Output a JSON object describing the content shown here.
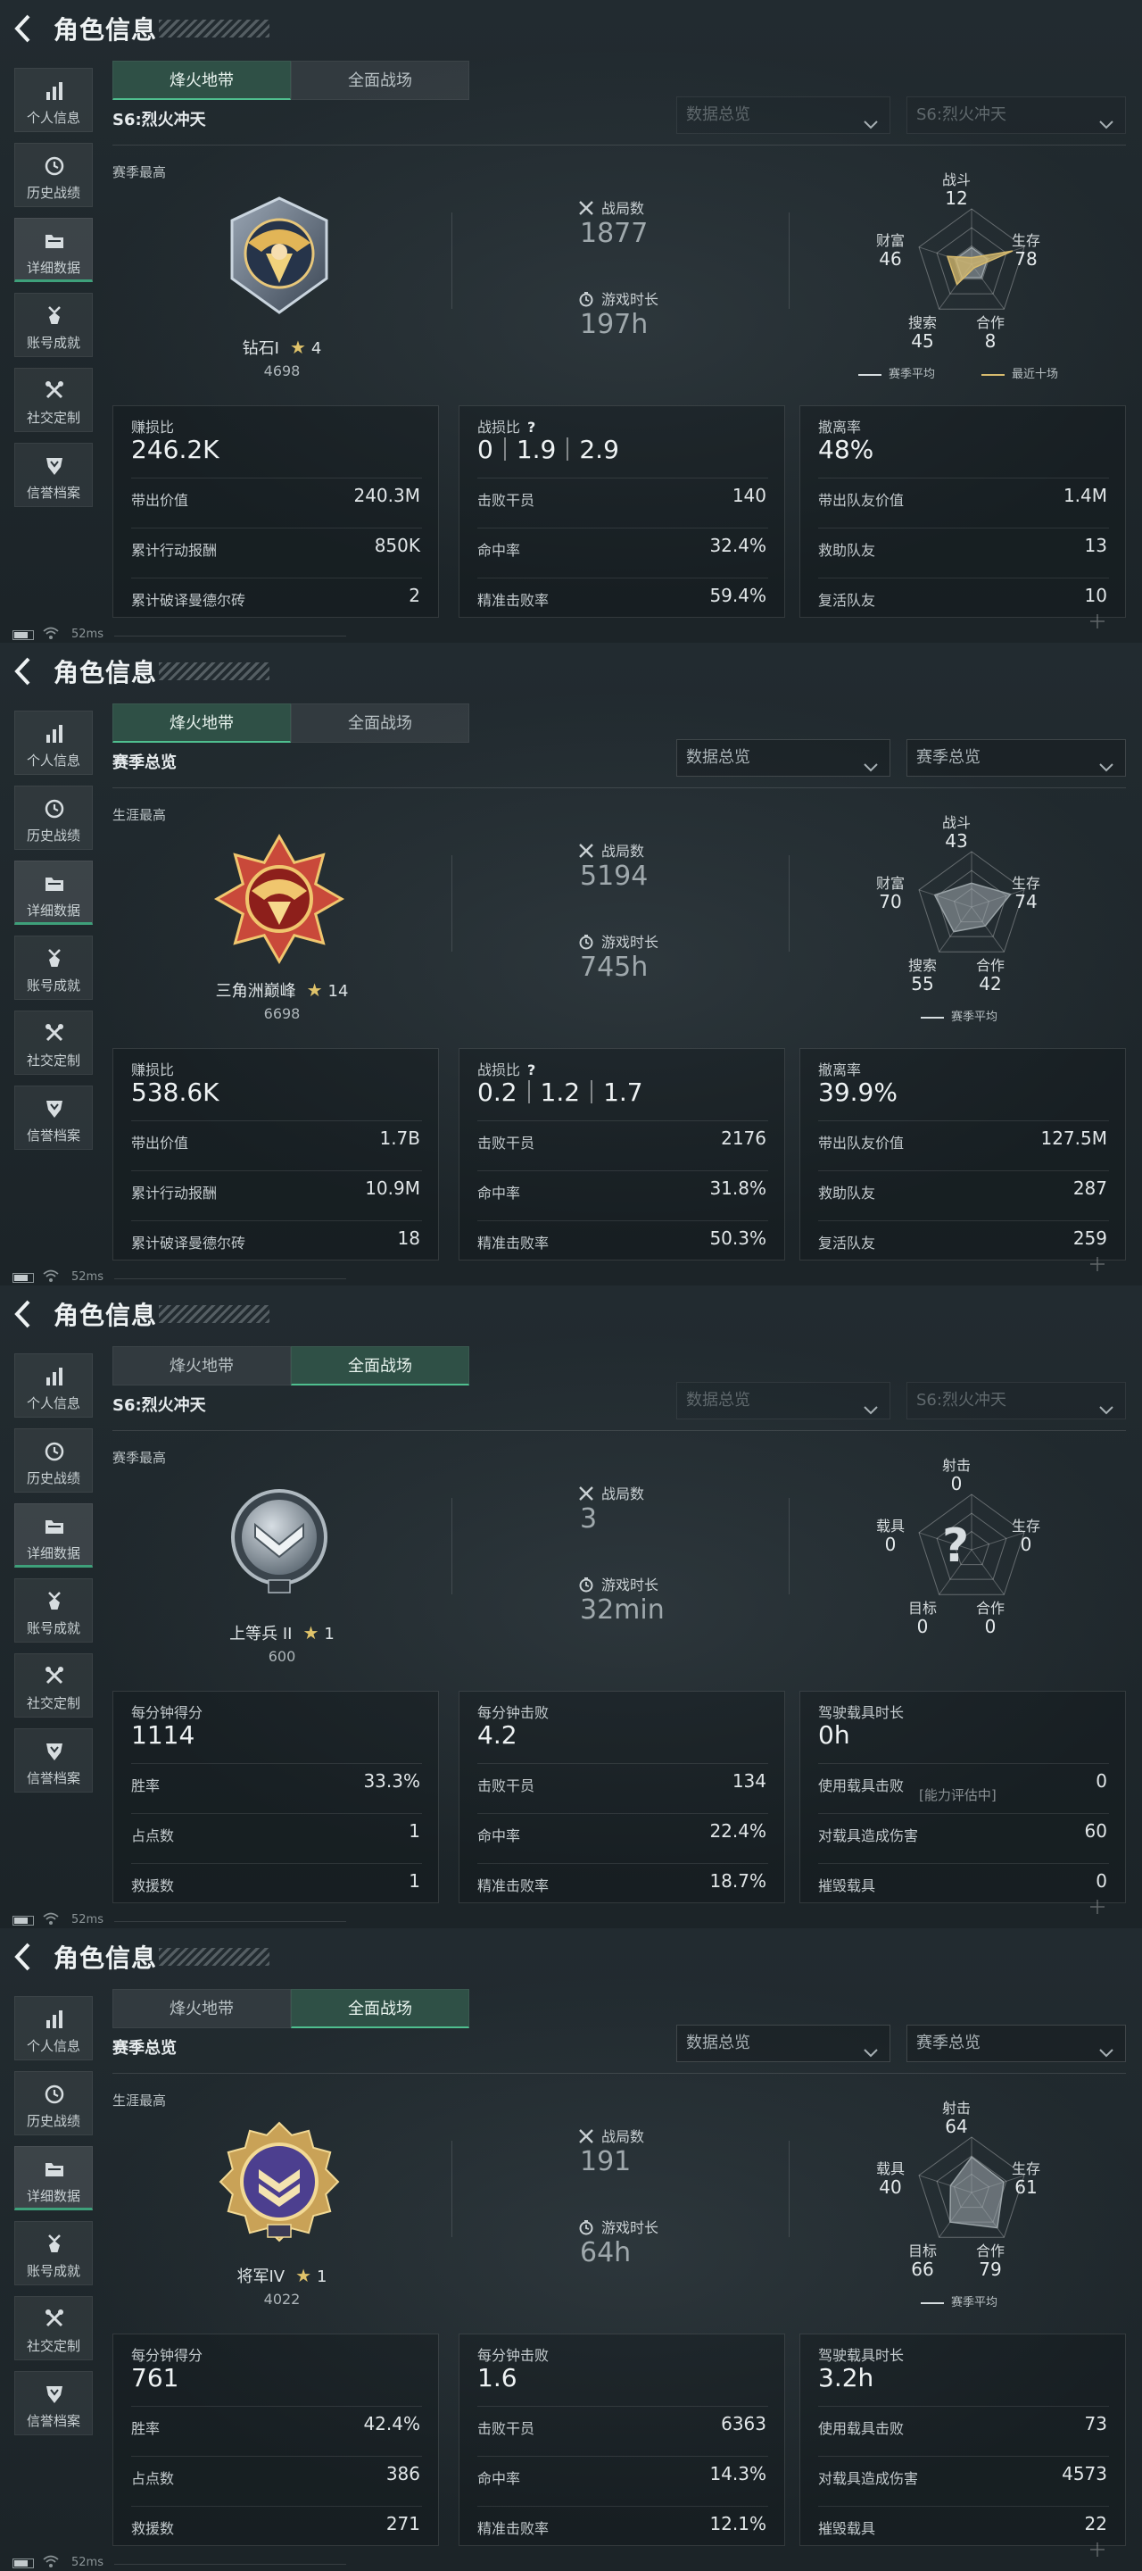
{
  "header": {
    "title": "角色信息"
  },
  "sidebar": {
    "items": [
      {
        "label": "个人信息",
        "icon": "bar-chart-icon"
      },
      {
        "label": "历史战绩",
        "icon": "clock-icon"
      },
      {
        "label": "详细数据",
        "icon": "folder-icon"
      },
      {
        "label": "账号成就",
        "icon": "medal-icon"
      },
      {
        "label": "社交定制",
        "icon": "tools-icon"
      },
      {
        "label": "信誉档案",
        "icon": "shield-icon"
      }
    ]
  },
  "tabs": {
    "fire": "烽火地带",
    "full": "全面战场"
  },
  "status": {
    "ping": "52ms"
  },
  "panels": [
    {
      "active_tab": "fire",
      "subtitle": "S6:烈火冲天",
      "dropdown1": "数据总览",
      "dropdown2": "S6:烈火冲天",
      "dropdowns_dimmed": true,
      "best_label": "赛季最高",
      "rank_name": "钻石I",
      "stars": "4",
      "score": "4698",
      "matches_label": "战局数",
      "matches": "1877",
      "time_label": "游戏时长",
      "time": "197h",
      "radar": {
        "axes": [
          "战斗",
          "生存",
          "合作",
          "搜索",
          "财富"
        ],
        "values": [
          "12",
          "78",
          "8",
          "45",
          "46"
        ],
        "avg": [
          0.3,
          0.3,
          0.3,
          0.3,
          0.3
        ],
        "recent": [
          0.12,
          0.78,
          0.08,
          0.45,
          0.46
        ],
        "unknown": false,
        "legend_avg": "赛季平均",
        "legend_recent": "最近十场"
      },
      "boxes": [
        {
          "head": "赚损比",
          "big": "246.2K",
          "rows": [
            [
              "带出价值",
              "240.3M"
            ],
            [
              "累计行动报酬",
              "850K"
            ],
            [
              "累计破译曼德尔砖",
              "2"
            ]
          ]
        },
        {
          "head": "战损比",
          "kd": [
            "0",
            "1.9",
            "2.9"
          ],
          "q": "?",
          "rows": [
            [
              "击败干员",
              "140"
            ],
            [
              "命中率",
              "32.4%"
            ],
            [
              "精准击败率",
              "59.4%"
            ]
          ]
        },
        {
          "head": "撤离率",
          "big": "48%",
          "rows": [
            [
              "带出队友价值",
              "1.4M"
            ],
            [
              "救助队友",
              "13"
            ],
            [
              "复活队友",
              "10"
            ]
          ]
        }
      ]
    },
    {
      "active_tab": "fire",
      "subtitle": "赛季总览",
      "dropdown1": "数据总览",
      "dropdown2": "赛季总览",
      "dropdowns_dimmed": false,
      "best_label": "生涯最高",
      "rank_name": "三角洲巅峰",
      "stars": "14",
      "score": "6698",
      "matches_label": "战局数",
      "matches": "5194",
      "time_label": "游戏时长",
      "time": "745h",
      "radar": {
        "axes": [
          "战斗",
          "生存",
          "合作",
          "搜索",
          "财富"
        ],
        "values": [
          "43",
          "74",
          "42",
          "55",
          "70"
        ],
        "avg": [
          0.43,
          0.74,
          0.42,
          0.55,
          0.7
        ],
        "unknown": false,
        "legend_avg": "赛季平均"
      },
      "boxes": [
        {
          "head": "赚损比",
          "big": "538.6K",
          "rows": [
            [
              "带出价值",
              "1.7B"
            ],
            [
              "累计行动报酬",
              "10.9M"
            ],
            [
              "累计破译曼德尔砖",
              "18"
            ]
          ]
        },
        {
          "head": "战损比",
          "kd": [
            "0.2",
            "1.2",
            "1.7"
          ],
          "q": "?",
          "rows": [
            [
              "击败干员",
              "2176"
            ],
            [
              "命中率",
              "31.8%"
            ],
            [
              "精准击败率",
              "50.3%"
            ]
          ]
        },
        {
          "head": "撤离率",
          "big": "39.9%",
          "rows": [
            [
              "带出队友价值",
              "127.5M"
            ],
            [
              "救助队友",
              "287"
            ],
            [
              "复活队友",
              "259"
            ]
          ]
        }
      ]
    },
    {
      "active_tab": "full",
      "subtitle": "S6:烈火冲天",
      "dropdown1": "数据总览",
      "dropdown2": "S6:烈火冲天",
      "dropdowns_dimmed": true,
      "best_label": "赛季最高",
      "rank_name": "上等兵 II",
      "stars": "1",
      "score": "600",
      "matches_label": "战局数",
      "matches": "3",
      "time_label": "游戏时长",
      "time": "32min",
      "radar": {
        "axes": [
          "射击",
          "生存",
          "合作",
          "目标",
          "载具"
        ],
        "values": [
          "0",
          "0",
          "0",
          "0",
          "0"
        ],
        "unknown": true,
        "q": "?",
        "assess": "[能力评估中]"
      },
      "boxes": [
        {
          "head": "每分钟得分",
          "big": "1114",
          "rows": [
            [
              "胜率",
              "33.3%"
            ],
            [
              "占点数",
              "1"
            ],
            [
              "救援数",
              "1"
            ]
          ]
        },
        {
          "head": "每分钟击败",
          "big": "4.2",
          "rows": [
            [
              "击败干员",
              "134"
            ],
            [
              "命中率",
              "22.4%"
            ],
            [
              "精准击败率",
              "18.7%"
            ]
          ]
        },
        {
          "head": "驾驶载具时长",
          "big": "0h",
          "rows": [
            [
              "使用载具击败",
              "0"
            ],
            [
              "对载具造成伤害",
              "60"
            ],
            [
              "摧毁载具",
              "0"
            ]
          ]
        }
      ]
    },
    {
      "active_tab": "full",
      "subtitle": "赛季总览",
      "dropdown1": "数据总览",
      "dropdown2": "赛季总览",
      "dropdowns_dimmed": false,
      "best_label": "生涯最高",
      "rank_name": "将军IV",
      "stars": "1",
      "score": "4022",
      "matches_label": "战局数",
      "matches": "191",
      "time_label": "游戏时长",
      "time": "64h",
      "radar": {
        "axes": [
          "射击",
          "生存",
          "合作",
          "目标",
          "载具"
        ],
        "values": [
          "64",
          "61",
          "79",
          "66",
          "40"
        ],
        "avg": [
          0.64,
          0.61,
          0.79,
          0.66,
          0.4
        ],
        "unknown": false,
        "legend_avg": "赛季平均"
      },
      "boxes": [
        {
          "head": "每分钟得分",
          "big": "761",
          "rows": [
            [
              "胜率",
              "42.4%"
            ],
            [
              "占点数",
              "386"
            ],
            [
              "救援数",
              "271"
            ]
          ]
        },
        {
          "head": "每分钟击败",
          "big": "1.6",
          "rows": [
            [
              "击败干员",
              "6363"
            ],
            [
              "命中率",
              "14.3%"
            ],
            [
              "精准击败率",
              "12.1%"
            ]
          ]
        },
        {
          "head": "驾驶载具时长",
          "big": "3.2h",
          "rows": [
            [
              "使用载具击败",
              "73"
            ],
            [
              "对载具造成伤害",
              "4573"
            ],
            [
              "摧毁载具",
              "22"
            ]
          ]
        }
      ]
    }
  ],
  "colors": {
    "accent": "#3ea07a",
    "gold": "#d7bb6e",
    "radar_avg": "#9aa3a7"
  }
}
